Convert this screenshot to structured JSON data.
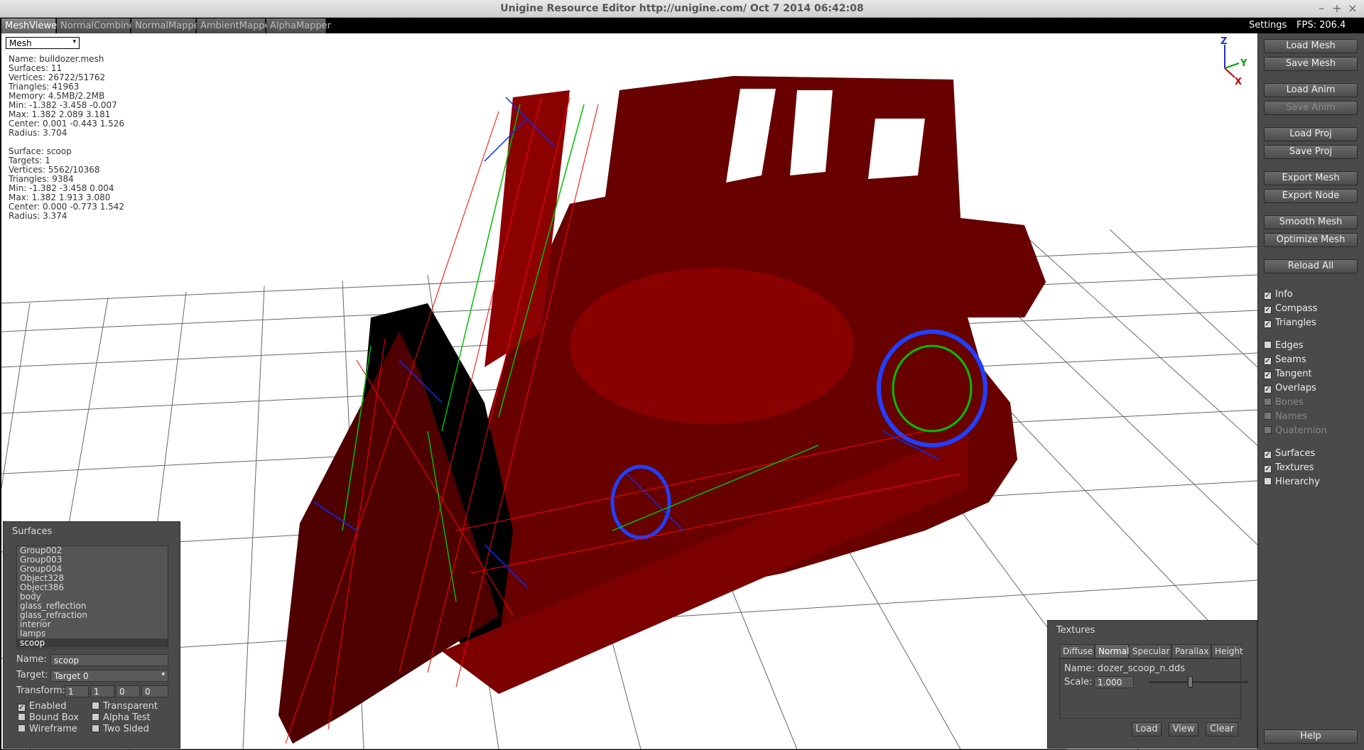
{
  "window": {
    "title": "Unigine Resource Editor http://unigine.com/  Oct  7 2014 06:42:08",
    "controls": [
      "–",
      "+",
      "×"
    ]
  },
  "tabs": [
    {
      "label": "MeshViewer",
      "active": true
    },
    {
      "label": "NormalCombiner",
      "active": false
    },
    {
      "label": "NormalMapper",
      "active": false
    },
    {
      "label": "AmbientMapper",
      "active": false
    },
    {
      "label": "AlphaMapper",
      "active": false
    }
  ],
  "topright": {
    "settings": "Settings",
    "fps": "FPS: 206.4"
  },
  "viewport": {
    "mode_select": "Mesh",
    "mesh_info": [
      "Name: bulldozer.mesh",
      "Surfaces: 11",
      "Vertices: 26722/51762",
      "Triangles: 41963",
      "Memory: 4.5MB/2.2MB",
      "Min: -1.382 -3.458 -0.007",
      "Max: 1.382 2.089 3.181",
      "Center: 0.001 -0.443 1.526",
      "Radius: 3.704"
    ],
    "surface_info": [
      "Surface: scoop",
      "Targets: 1",
      "Vertices: 5562/10368",
      "Triangles: 9384",
      "Min: -1.382 -3.458 0.004",
      "Max: 1.382 1.913 3.080",
      "Center: 0.000 -0.773 1.542",
      "Radius: 3.374"
    ],
    "compass": {
      "z": "Z",
      "y": "Y",
      "x": "X"
    }
  },
  "surfaces_panel": {
    "title": "Surfaces",
    "items": [
      "Group002",
      "Group003",
      "Group004",
      "Object328",
      "Object386",
      "body",
      "glass_reflection",
      "glass_refraction",
      "interior",
      "lamps",
      "scoop"
    ],
    "selected": "scoop",
    "name_label": "Name:",
    "name_value": "scoop",
    "target_label": "Target:",
    "target_value": "Target 0",
    "transform_label": "Transform:",
    "transform_values": [
      "1",
      "1",
      "0",
      "0"
    ],
    "checkboxes": [
      {
        "label": "Enabled",
        "checked": true
      },
      {
        "label": "Transparent",
        "checked": false
      },
      {
        "label": "Bound Box",
        "checked": false
      },
      {
        "label": "Alpha Test",
        "checked": false
      },
      {
        "label": "Wireframe",
        "checked": false
      },
      {
        "label": "Two Sided",
        "checked": false
      }
    ]
  },
  "textures_panel": {
    "title": "Textures",
    "tabs": [
      "Diffuse",
      "Normal",
      "Specular",
      "Parallax",
      "Height"
    ],
    "active_tab": "Normal",
    "name_line": "Name: dozer_scoop_n.dds",
    "scale_label": "Scale:",
    "scale_value": "1.000",
    "buttons": [
      "Load",
      "View",
      "Clear"
    ]
  },
  "sidebar": {
    "buttons": [
      {
        "label": "Load Mesh",
        "enabled": true
      },
      {
        "label": "Save Mesh",
        "enabled": true
      },
      {
        "label": "Load Anim",
        "enabled": true
      },
      {
        "label": "Save Anim",
        "enabled": false
      },
      {
        "label": "Load Proj",
        "enabled": true
      },
      {
        "label": "Save Proj",
        "enabled": true
      },
      {
        "label": "Export Mesh",
        "enabled": true
      },
      {
        "label": "Export Node",
        "enabled": true
      },
      {
        "label": "Smooth Mesh",
        "enabled": true
      },
      {
        "label": "Optimize Mesh",
        "enabled": true
      },
      {
        "label": "Reload All",
        "enabled": true
      }
    ],
    "checks": [
      {
        "label": "Info",
        "checked": true,
        "enabled": true
      },
      {
        "label": "Compass",
        "checked": true,
        "enabled": true
      },
      {
        "label": "Triangles",
        "checked": true,
        "enabled": true
      },
      {
        "label": "Edges",
        "checked": false,
        "enabled": true
      },
      {
        "label": "Seams",
        "checked": true,
        "enabled": true
      },
      {
        "label": "Tangent",
        "checked": true,
        "enabled": true
      },
      {
        "label": "Overlaps",
        "checked": true,
        "enabled": true
      },
      {
        "label": "Bones",
        "checked": false,
        "enabled": false
      },
      {
        "label": "Names",
        "checked": false,
        "enabled": false
      },
      {
        "label": "Quaternion",
        "checked": false,
        "enabled": false
      },
      {
        "label": "Surfaces",
        "checked": true,
        "enabled": true
      },
      {
        "label": "Textures",
        "checked": true,
        "enabled": true
      },
      {
        "label": "Hierarchy",
        "checked": false,
        "enabled": true
      }
    ],
    "help": "Help"
  }
}
